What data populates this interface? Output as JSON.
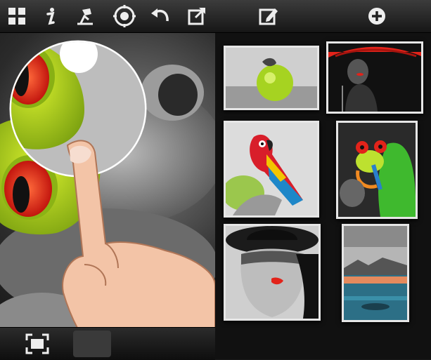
{
  "toolbar": {
    "icons": [
      "grid-icon",
      "info-icon",
      "brush-lamp-icon",
      "target-icon",
      "undo-icon",
      "share-icon",
      "edit-icon",
      "add-icon"
    ]
  },
  "editor": {
    "image": "frog-color-splash",
    "zoom_loupe": "magnifier"
  },
  "gallery": {
    "items": [
      {
        "name": "green-apple"
      },
      {
        "name": "red-umbrella-woman"
      },
      {
        "name": "parrot"
      },
      {
        "name": "tree-frog"
      },
      {
        "name": "woman-in-hat-red-lips"
      },
      {
        "name": "lake-landscape"
      }
    ]
  },
  "colors": {
    "accent_red": "#e2231a",
    "accent_green": "#a6d321",
    "toolbar_bg": "#262626"
  },
  "bottombar": {
    "icons": [
      "fit-screen-icon"
    ]
  }
}
